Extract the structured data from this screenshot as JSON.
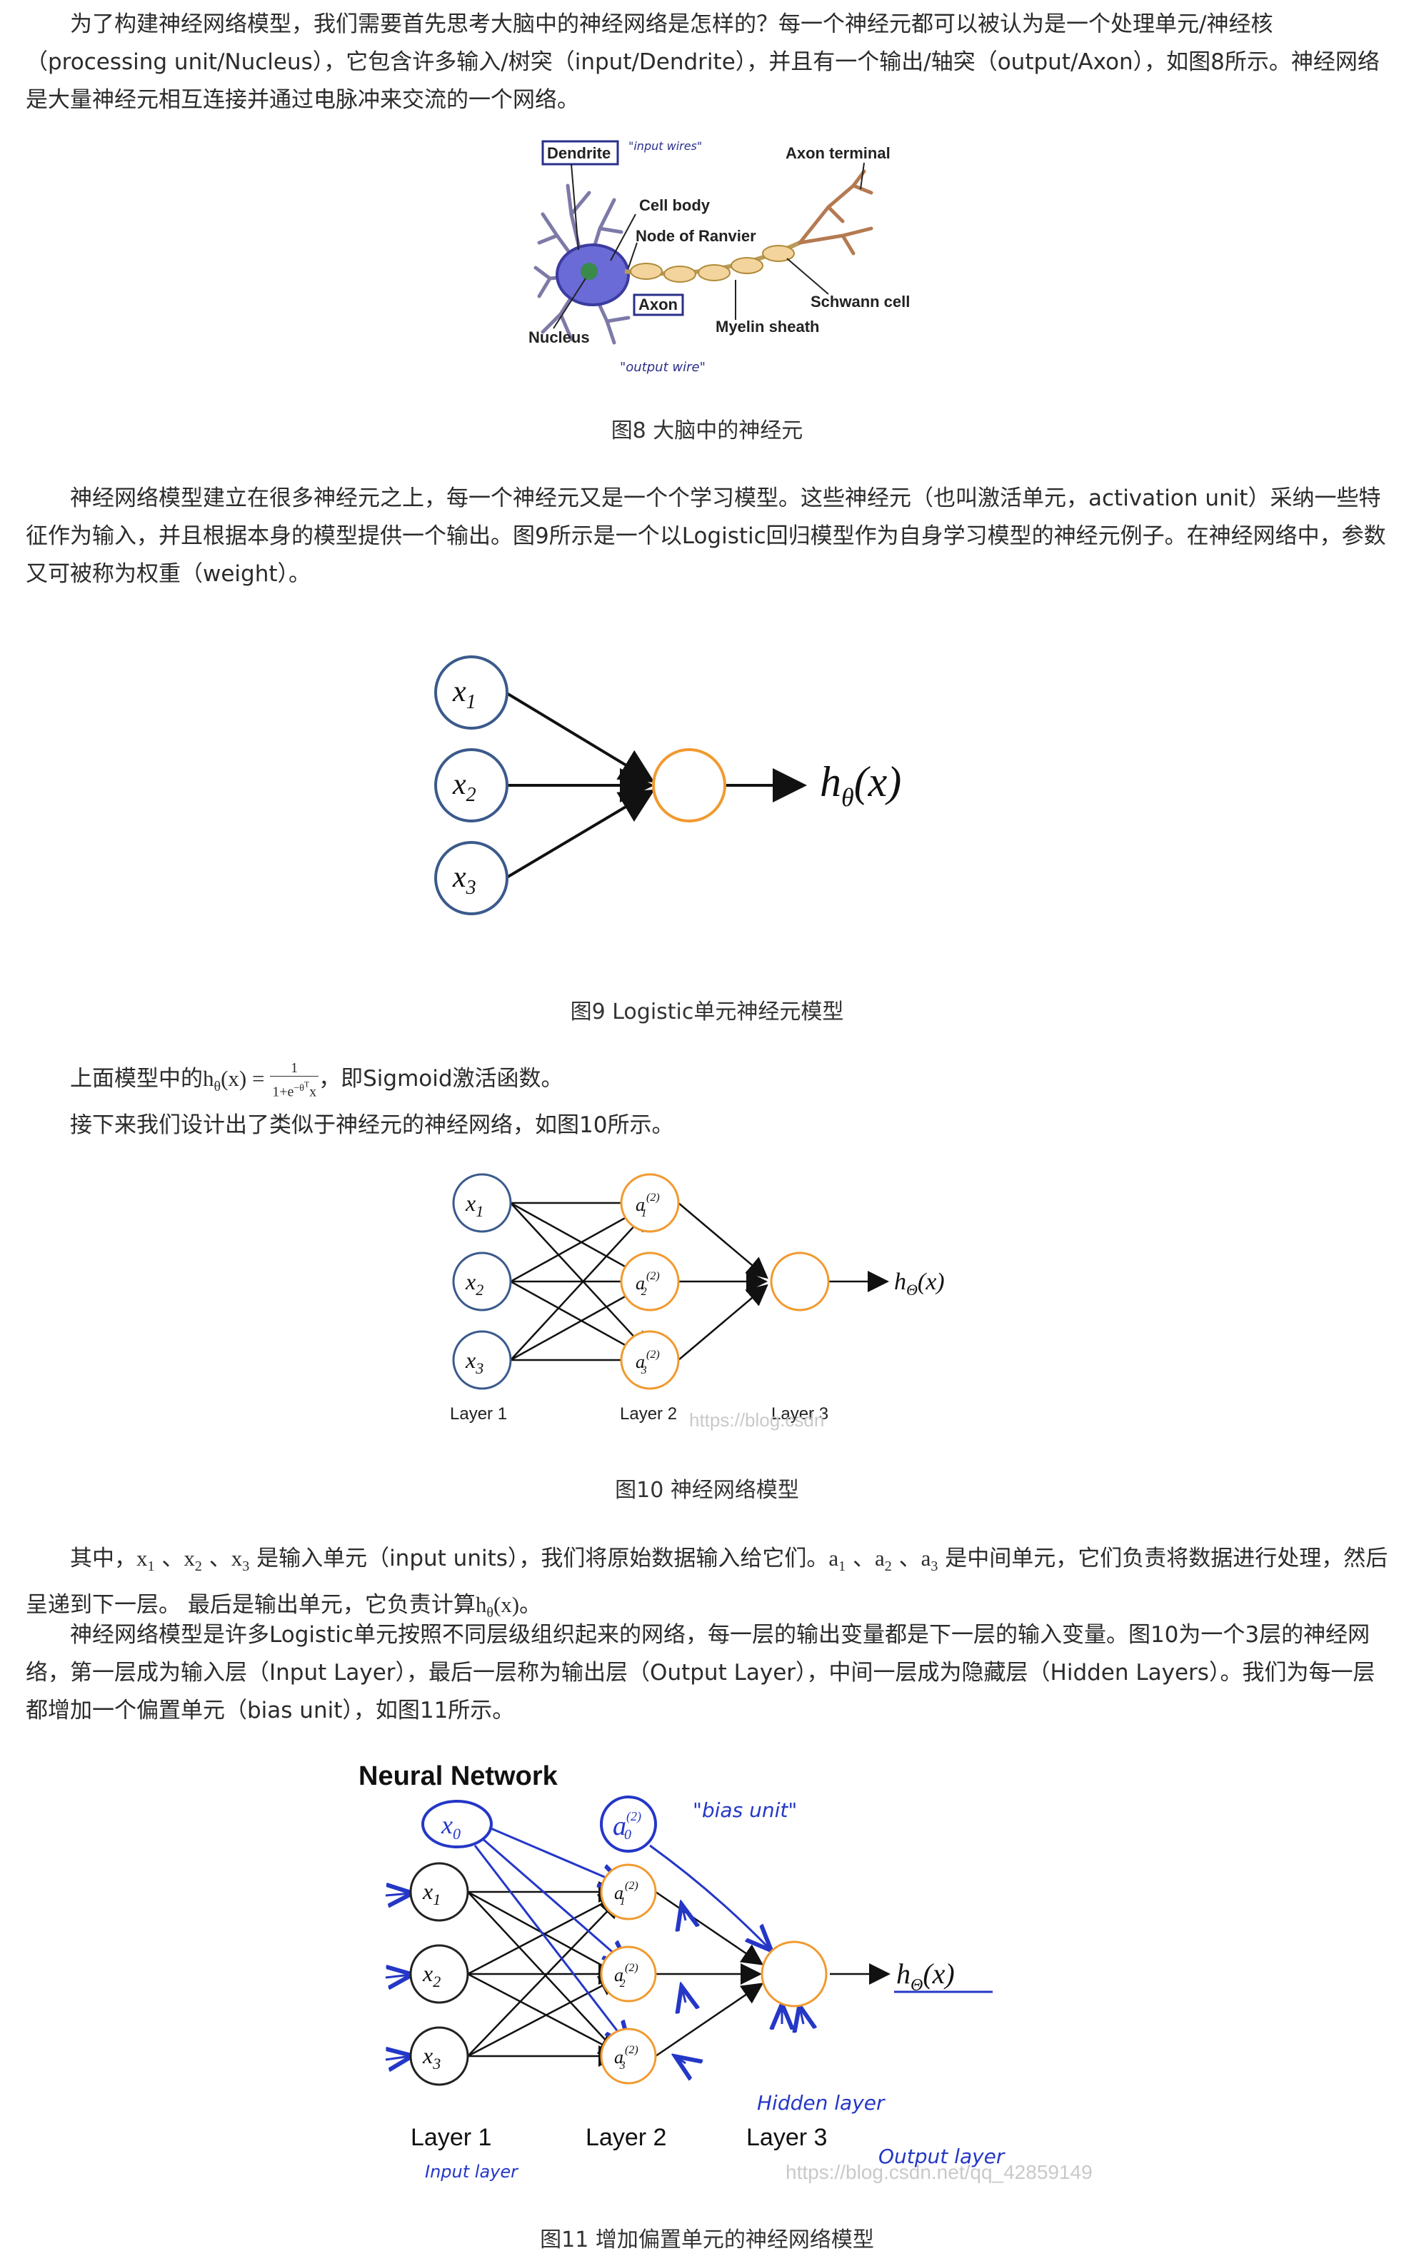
{
  "p1": "为了构建神经网络模型，我们需要首先思考大脑中的神经网络是怎样的？每一个神经元都可以被认为是一个处理单元/神经核（processing unit/Nucleus），它包含许多输入/树突（input/Dendrite），并且有一个输出/轴突（output/Axon），如图8所示。神经网络是大量神经元相互连接并通过电脉冲来交流的一个网络。",
  "fig8": {
    "caption": "图8 大脑中的神经元",
    "labels": {
      "dendrite": "Dendrite",
      "input_wires": "\"input wires\"",
      "axon_terminal": "Axon terminal",
      "cell_body": "Cell body",
      "node_of_ranvier": "Node of Ranvier",
      "axon": "Axon",
      "schwann_cell": "Schwann cell",
      "myelin_sheath": "Myelin sheath",
      "nucleus": "Nucleus",
      "output_wire": "\"output wire\""
    }
  },
  "p2": "神经网络模型建立在很多神经元之上，每一个神经元又是一个个学习模型。这些神经元（也叫激活单元，activation unit）采纳一些特征作为输入，并且根据本身的模型提供一个输出。图9所示是一个以Logistic回归模型作为自身学习模型的神经元例子。在神经网络中，参数又可被称为权重（weight）。",
  "fig9": {
    "caption": "图9 Logistic单元神经元模型",
    "inputs": [
      "x",
      "x",
      "x"
    ],
    "input_subs": [
      "1",
      "2",
      "3"
    ],
    "output_h": "h",
    "output_sub": "θ",
    "output_arg": "(x)"
  },
  "p3": {
    "prefix": "上面模型中的",
    "formula_lhs": "h",
    "formula_sub": "θ",
    "formula_arg": "(x) = ",
    "frac_num": "1",
    "frac_den": "1+e",
    "frac_exp": "−θ",
    "frac_exp_sup": "T",
    "frac_den_tail": "x",
    "suffix": "，即Sigmoid激活函数。"
  },
  "p4": "接下来我们设计出了类似于神经元的神经网络，如图10所示。",
  "fig10": {
    "caption": "图10 神经网络模型",
    "inputs": [
      "x",
      "x",
      "x"
    ],
    "input_subs": [
      "1",
      "2",
      "3"
    ],
    "hidden": [
      "a",
      "a",
      "a"
    ],
    "hidden_subs": [
      "1",
      "2",
      "3"
    ],
    "hidden_sup": "(2)",
    "output_h": "h",
    "output_sub": "Θ",
    "output_arg": "(x)",
    "layers": [
      "Layer 1",
      "Layer 2",
      "Layer 3"
    ],
    "watermark": "https://blog.csdn"
  },
  "p5": {
    "t1": "其中，",
    "x1": "x",
    "x1s": "1",
    "sep1": " 、",
    "x2": "x",
    "x2s": "2",
    "sep2": " 、",
    "x3": "x",
    "x3s": "3",
    "t2": " 是输入单元（input units），我们将原始数据输入给它们。",
    "a1": "a",
    "a1s": "1",
    "sep3": " 、",
    "a2": "a",
    "a2s": "2",
    "sep4": " 、",
    "a3": "a",
    "a3s": "3",
    "t3": " 是中间单元，它们负责将数据进行处理，然后呈递到下一层。 最后是输出单元，它负责计算",
    "h": "h",
    "hs": "θ",
    "harg": "(x)",
    "t4": "。"
  },
  "p6": "神经网络模型是许多Logistic单元按照不同层级组织起来的网络，每一层的输出变量都是下一层的输入变量。图10为一个3层的神经网络，第一层成为输入层（Input Layer），最后一层称为输出层（Output Layer），中间一层成为隐藏层（Hidden Layers）。我们为每一层都增加一个偏置单元（bias unit），如图11所示。",
  "fig11": {
    "caption": "图11 增加偏置单元的神经网络模型",
    "title": "Neural Network",
    "bias_x": "x",
    "bias_x_sub": "0",
    "bias_a": "a",
    "bias_a_sub": "0",
    "bias_a_sup": "(2)",
    "bias_note": "\"bias unit\"",
    "inputs": [
      "x",
      "x",
      "x"
    ],
    "input_subs": [
      "1",
      "2",
      "3"
    ],
    "hidden": [
      "a",
      "a",
      "a"
    ],
    "hidden_subs": [
      "1",
      "2",
      "3"
    ],
    "hidden_sup": "(2)",
    "output_h": "h",
    "output_sub": "Θ",
    "output_arg": "(x)",
    "layers": [
      "Layer 1",
      "Layer 2",
      "Layer 3"
    ],
    "hidden_layer_note": "Hidden layer",
    "input_layer_note": "Input layer",
    "output_layer_note": "Output layer",
    "watermark": "https://blog.csdn.net/qq_42859149"
  }
}
